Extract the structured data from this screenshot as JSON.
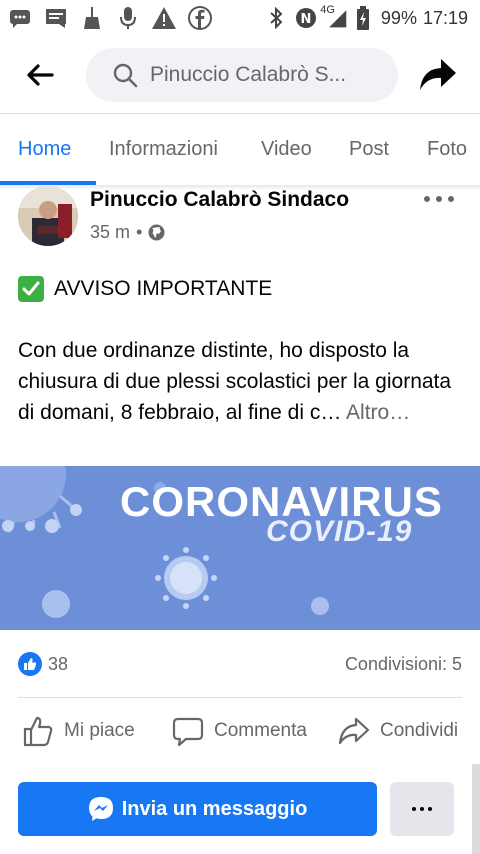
{
  "status_bar": {
    "battery": "99%",
    "time": "17:19",
    "network": "4G",
    "icons_left": [
      "message-icon",
      "sms-icon",
      "broom-icon",
      "microphone-icon",
      "warning-icon",
      "facebook-icon"
    ],
    "icons_right": [
      "bluetooth-icon",
      "nfc-icon",
      "signal-icon",
      "battery-icon"
    ]
  },
  "topbar": {
    "search_text": "Pinuccio Calabrò S..."
  },
  "tabs": [
    {
      "label": "Home",
      "active": true
    },
    {
      "label": "Informazioni",
      "active": false
    },
    {
      "label": "Video",
      "active": false
    },
    {
      "label": "Post",
      "active": false
    },
    {
      "label": "Foto",
      "active": false
    }
  ],
  "post": {
    "author": "Pinuccio Calabrò Sindaco",
    "time": "35 m",
    "separator": "•",
    "audience_icon": "globe-icon",
    "title": "AVVISO IMPORTANTE",
    "body": "Con due ordinanze distinte, ho disposto la chiusura di due plessi scolastici per la giornata di domani, 8 febbraio, al fine di c…",
    "see_more": "Altro…",
    "image_title": "CORONAVIRUS",
    "image_subtitle": "COVID-19",
    "likes": "38",
    "shares": "Condivisioni: 5",
    "actions": {
      "like": "Mi piace",
      "comment": "Commenta",
      "share": "Condividi"
    }
  },
  "bottom": {
    "message_label": "Invia un messaggio"
  },
  "colors": {
    "accent": "#1877f2",
    "image_bg": "#6b8dd6",
    "check_green": "#3cb043"
  }
}
